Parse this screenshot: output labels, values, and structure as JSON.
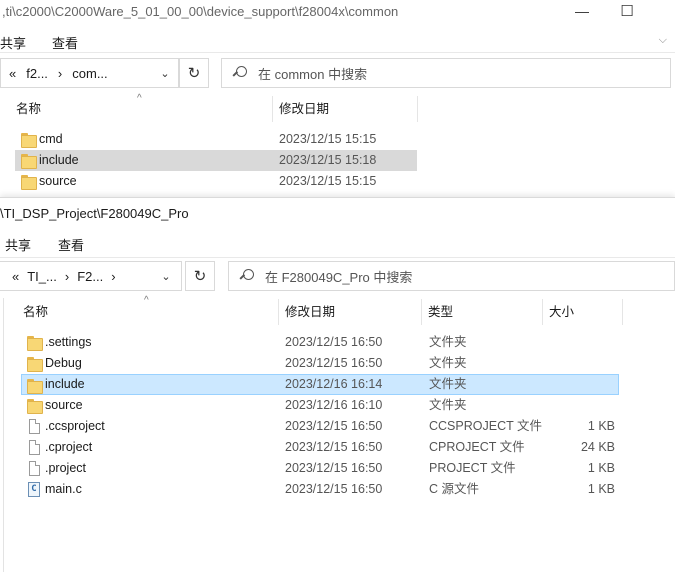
{
  "win1": {
    "title": ",ti\\c2000\\C2000Ware_5_01_00_00\\device_support\\f28004x\\common",
    "ribbon": {
      "share": "共享",
      "view": "查看"
    },
    "address": {
      "back": "«",
      "seg1": "f2...",
      "seg2": "com...",
      "sep": "›"
    },
    "search_placeholder": "在 common 中搜索",
    "columns": {
      "name": "名称",
      "date": "修改日期"
    },
    "files": [
      {
        "name": "cmd",
        "date": "2023/12/15 15:15",
        "icon": "folder-icon"
      },
      {
        "name": "include",
        "date": "2023/12/15 15:18",
        "icon": "folder-icon"
      },
      {
        "name": "source",
        "date": "2023/12/15 15:15",
        "icon": "folder-icon"
      }
    ]
  },
  "win2": {
    "title": "\\TI_DSP_Project\\F280049C_Pro",
    "ribbon": {
      "share": "共享",
      "view": "查看"
    },
    "address": {
      "back": "«",
      "seg1": "TI_...",
      "seg2": "F2...",
      "sep": "›"
    },
    "search_placeholder": "在 F280049C_Pro 中搜索",
    "columns": {
      "name": "名称",
      "date": "修改日期",
      "type": "类型",
      "size": "大小"
    },
    "files": [
      {
        "name": ".settings",
        "date": "2023/12/15 16:50",
        "type": "文件夹",
        "size": "",
        "icon": "folder-icon"
      },
      {
        "name": "Debug",
        "date": "2023/12/15 16:50",
        "type": "文件夹",
        "size": "",
        "icon": "folder-icon"
      },
      {
        "name": "include",
        "date": "2023/12/16 16:14",
        "type": "文件夹",
        "size": "",
        "icon": "folder-icon"
      },
      {
        "name": "source",
        "date": "2023/12/16 16:10",
        "type": "文件夹",
        "size": "",
        "icon": "folder-icon"
      },
      {
        "name": ".ccsproject",
        "date": "2023/12/15 16:50",
        "type": "CCSPROJECT 文件",
        "size": "1 KB",
        "icon": "file-icon"
      },
      {
        "name": ".cproject",
        "date": "2023/12/15 16:50",
        "type": "CPROJECT 文件",
        "size": "24 KB",
        "icon": "file-icon"
      },
      {
        "name": ".project",
        "date": "2023/12/15 16:50",
        "type": "PROJECT 文件",
        "size": "1 KB",
        "icon": "file-icon"
      },
      {
        "name": "main.c",
        "date": "2023/12/15 16:50",
        "type": "C 源文件",
        "size": "1 KB",
        "icon": "c-source-icon"
      }
    ]
  },
  "icons": {
    "c_glyph": "C",
    "minimize": "—",
    "maximize": "☐",
    "refresh": "↻",
    "dropdown": "⌄",
    "sort": "^",
    "collapse": "⌵"
  }
}
